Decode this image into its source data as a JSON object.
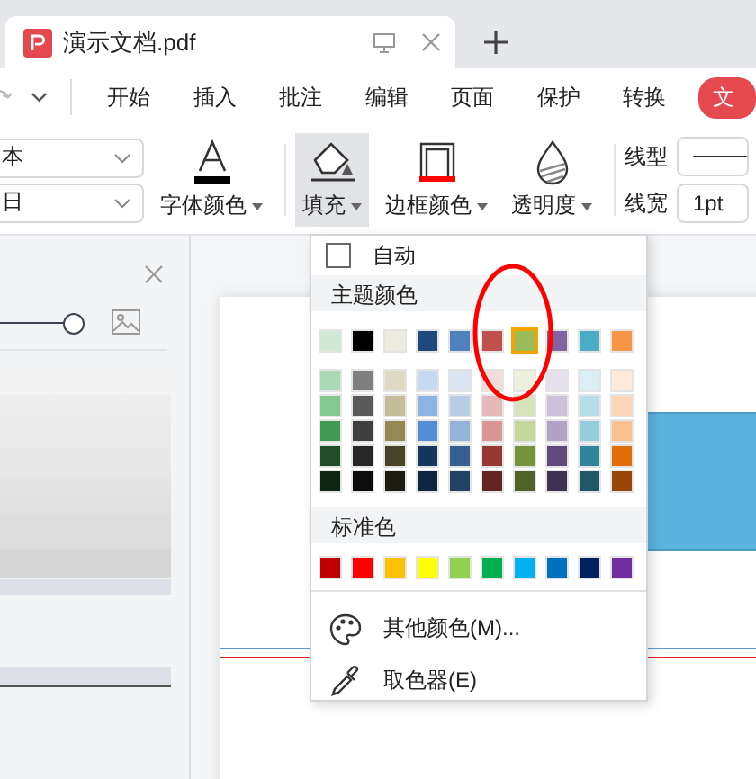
{
  "tab": {
    "title": "演示文档.pdf"
  },
  "menu": {
    "items": [
      "开始",
      "插入",
      "批注",
      "编辑",
      "页面",
      "保护",
      "转换"
    ],
    "badge": "文"
  },
  "font_fields": [
    {
      "value": "本"
    },
    {
      "value": "日"
    }
  ],
  "tools": [
    {
      "label": "字体颜色",
      "kind": "font-color",
      "selected": false
    },
    {
      "label": "填充",
      "kind": "fill",
      "selected": true
    },
    {
      "label": "边框颜色",
      "kind": "border-color",
      "selected": false
    },
    {
      "label": "透明度",
      "kind": "opacity",
      "selected": false
    }
  ],
  "line": {
    "type_label": "线型",
    "width_label": "线宽",
    "width_value": "1pt"
  },
  "side_panel": {
    "slider": {
      "level": 1
    }
  },
  "fill_menu": {
    "auto": {
      "label": "自动",
      "checked": false
    },
    "theme_header": "主题颜色",
    "theme": [
      {
        "color": "#d0e8d6",
        "selected": false
      },
      {
        "color": "#000000",
        "selected": false
      },
      {
        "color": "#eeece1",
        "selected": false
      },
      {
        "color": "#1f497d",
        "selected": false
      },
      {
        "color": "#4f81bd",
        "selected": false
      },
      {
        "color": "#c0504d",
        "selected": false
      },
      {
        "color": "#9bbb59",
        "selected": true
      },
      {
        "color": "#8064a2",
        "selected": false
      },
      {
        "color": "#4bacc6",
        "selected": false
      },
      {
        "color": "#f79646",
        "selected": false
      }
    ],
    "shades": [
      [
        {
          "color": "#a9dab5",
          "selected": false
        },
        {
          "color": "#7f7f7f",
          "selected": false
        },
        {
          "color": "#ddd9c3",
          "selected": false
        },
        {
          "color": "#c6d9f0",
          "selected": false
        },
        {
          "color": "#dbe5f1",
          "selected": false
        },
        {
          "color": "#f2dcdb",
          "selected": false
        },
        {
          "color": "#ebf1dd",
          "selected": false
        },
        {
          "color": "#e5e0ec",
          "selected": false
        },
        {
          "color": "#dbeef3",
          "selected": false
        },
        {
          "color": "#fdeada",
          "selected": false
        }
      ],
      [
        {
          "color": "#83c791",
          "selected": false
        },
        {
          "color": "#595959",
          "selected": false
        },
        {
          "color": "#c4bd97",
          "selected": false
        },
        {
          "color": "#8db3e2",
          "selected": false
        },
        {
          "color": "#b8cce4",
          "selected": false
        },
        {
          "color": "#e5b9b7",
          "selected": false
        },
        {
          "color": "#d7e3bc",
          "selected": false
        },
        {
          "color": "#ccc1d9",
          "selected": false
        },
        {
          "color": "#b7dde8",
          "selected": false
        },
        {
          "color": "#fbd5b5",
          "selected": false
        }
      ],
      [
        {
          "color": "#3f9a50",
          "selected": false
        },
        {
          "color": "#3f3f3f",
          "selected": false
        },
        {
          "color": "#938953",
          "selected": false
        },
        {
          "color": "#548dd4",
          "selected": false
        },
        {
          "color": "#95b3d7",
          "selected": false
        },
        {
          "color": "#d99694",
          "selected": false
        },
        {
          "color": "#c3d69b",
          "selected": false
        },
        {
          "color": "#b2a2c7",
          "selected": false
        },
        {
          "color": "#92cddc",
          "selected": false
        },
        {
          "color": "#fac08f",
          "selected": false
        }
      ],
      [
        {
          "color": "#1f4d27",
          "selected": false
        },
        {
          "color": "#262626",
          "selected": false
        },
        {
          "color": "#494429",
          "selected": false
        },
        {
          "color": "#17365d",
          "selected": false
        },
        {
          "color": "#366092",
          "selected": false
        },
        {
          "color": "#953734",
          "selected": false
        },
        {
          "color": "#76923c",
          "selected": false
        },
        {
          "color": "#5f497a",
          "selected": false
        },
        {
          "color": "#31859b",
          "selected": false
        },
        {
          "color": "#e36c09",
          "selected": false
        }
      ],
      [
        {
          "color": "#0f2614",
          "selected": false
        },
        {
          "color": "#0c0c0c",
          "selected": false
        },
        {
          "color": "#1d1b10",
          "selected": false
        },
        {
          "color": "#0f243e",
          "selected": false
        },
        {
          "color": "#244061",
          "selected": false
        },
        {
          "color": "#632423",
          "selected": false
        },
        {
          "color": "#4f6128",
          "selected": false
        },
        {
          "color": "#3f3151",
          "selected": false
        },
        {
          "color": "#205867",
          "selected": false
        },
        {
          "color": "#974806",
          "selected": false
        }
      ]
    ],
    "standard_header": "标准色",
    "standard": [
      {
        "color": "#c00000",
        "selected": false
      },
      {
        "color": "#ff0000",
        "selected": false
      },
      {
        "color": "#ffc000",
        "selected": false
      },
      {
        "color": "#ffff00",
        "selected": false
      },
      {
        "color": "#92d050",
        "selected": false
      },
      {
        "color": "#00b050",
        "selected": false
      },
      {
        "color": "#00b0f0",
        "selected": false
      },
      {
        "color": "#0070c0",
        "selected": false
      },
      {
        "color": "#002060",
        "selected": false
      },
      {
        "color": "#7030a0",
        "selected": false
      }
    ],
    "actions": [
      {
        "label": "其他颜色(M)...",
        "kind": "palette"
      },
      {
        "label": "取色器(E)",
        "kind": "eyedropper"
      }
    ]
  }
}
